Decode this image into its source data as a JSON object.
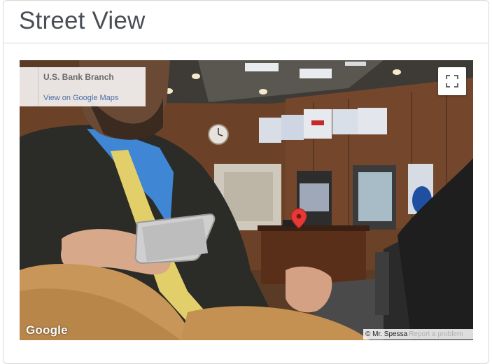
{
  "panel": {
    "title": "Street View"
  },
  "streetview": {
    "place_name": "U.S. Bank Branch",
    "view_link": "View on Google Maps",
    "logo": "Google",
    "attribution_author": "© Mr. Spessa",
    "report_link": "Report a problem",
    "icons": [
      "fullscreen-icon",
      "map-pin-icon"
    ],
    "colors": {
      "pin": "#e53935",
      "link": "#4b6ea8"
    }
  }
}
